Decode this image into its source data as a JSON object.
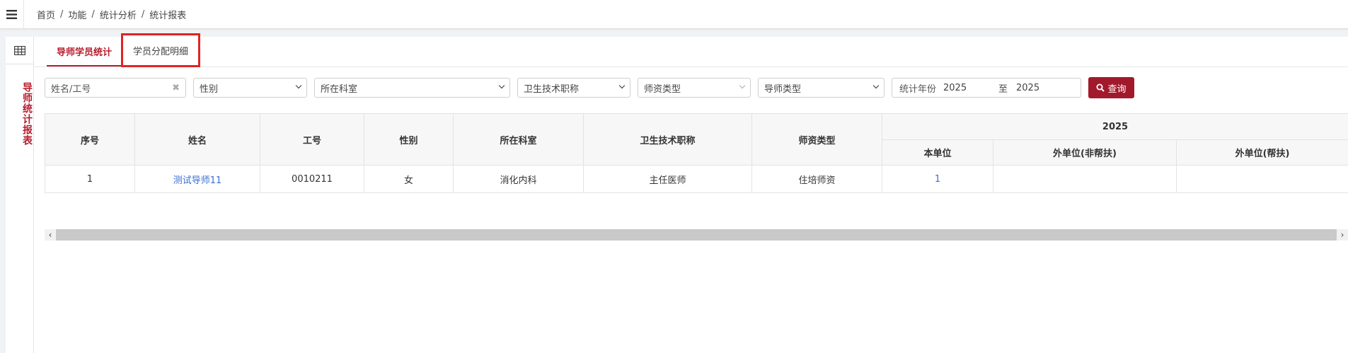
{
  "breadcrumb": [
    "首页",
    "功能",
    "统计分析",
    "统计报表"
  ],
  "sidebar": {
    "title": "导师统计报表"
  },
  "tabs": [
    {
      "label": "导师学员统计",
      "active": true
    },
    {
      "label": "学员分配明细",
      "active": false
    }
  ],
  "filters": {
    "name_placeholder": "姓名/工号",
    "gender": "性别",
    "department": "所在科室",
    "title": "卫生技术职称",
    "faculty_type": "师资类型",
    "mentor_type": "导师类型",
    "year_label": "统计年份",
    "year_from": "2025",
    "year_to_label": "至",
    "year_to": "2025",
    "query_label": "查询"
  },
  "table": {
    "headers": [
      "序号",
      "姓名",
      "工号",
      "性别",
      "所在科室",
      "卫生技术职称",
      "师资类型"
    ],
    "group_header": "2025",
    "sub_headers": [
      "本单位",
      "外单位(非帮扶)",
      "外单位(帮扶)"
    ],
    "rows": [
      {
        "no": "1",
        "name": "测试导师11",
        "id": "0010211",
        "gender": "女",
        "department": "消化内科",
        "title": "主任医师",
        "faculty_type": "住培师资",
        "own_unit": "1",
        "external_non_support": "",
        "external_support": ""
      }
    ]
  },
  "colors": {
    "accent": "#a3192c",
    "link": "#3b6fd1",
    "highlight_box": "#e02424"
  },
  "icons": {
    "menu": "hamburger-icon",
    "table": "table-icon",
    "search": "search-icon",
    "clear": "close-icon"
  }
}
